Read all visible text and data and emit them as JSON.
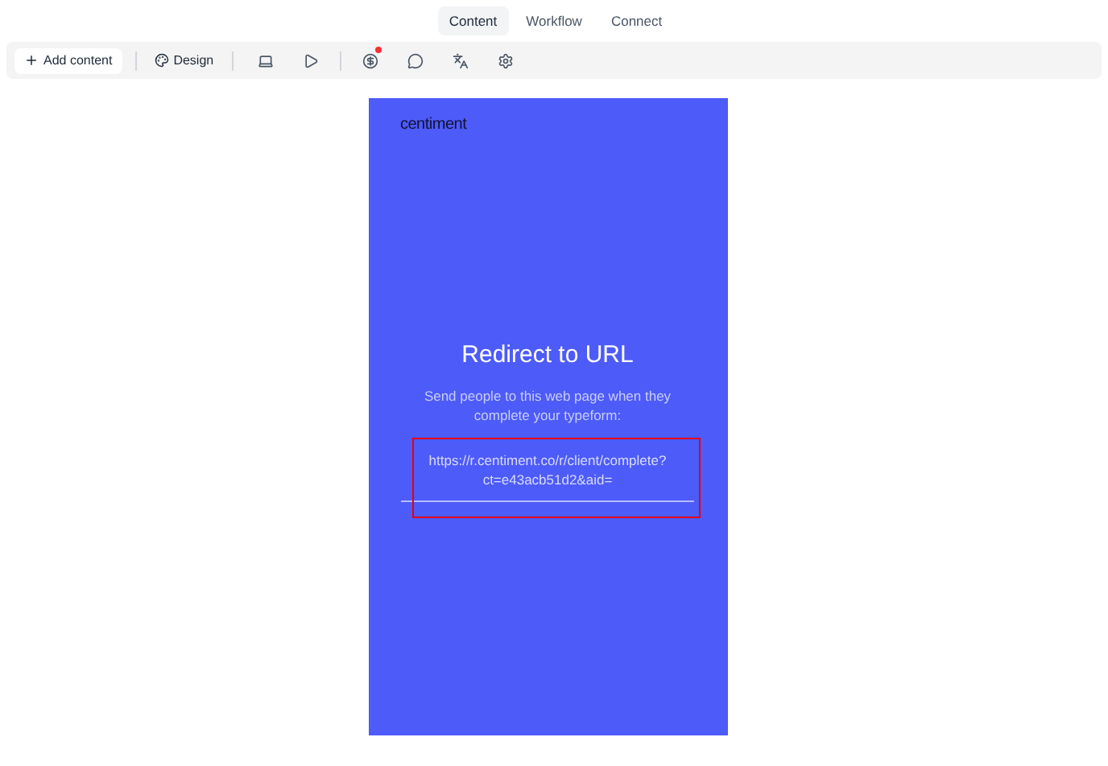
{
  "tabs": [
    {
      "label": "Content",
      "selected": true
    },
    {
      "label": "Workflow",
      "selected": false
    },
    {
      "label": "Connect",
      "selected": false
    }
  ],
  "toolbar": {
    "add_label": "Add content",
    "design_label": "Design",
    "alert_dot": true
  },
  "preview": {
    "logo": "centiment",
    "title": "Redirect to URL",
    "description": "Send people to this web page when they complete your typeform:",
    "url": "https://r.centiment.co/r/client/complete?ct=e43acb51d2&aid="
  }
}
